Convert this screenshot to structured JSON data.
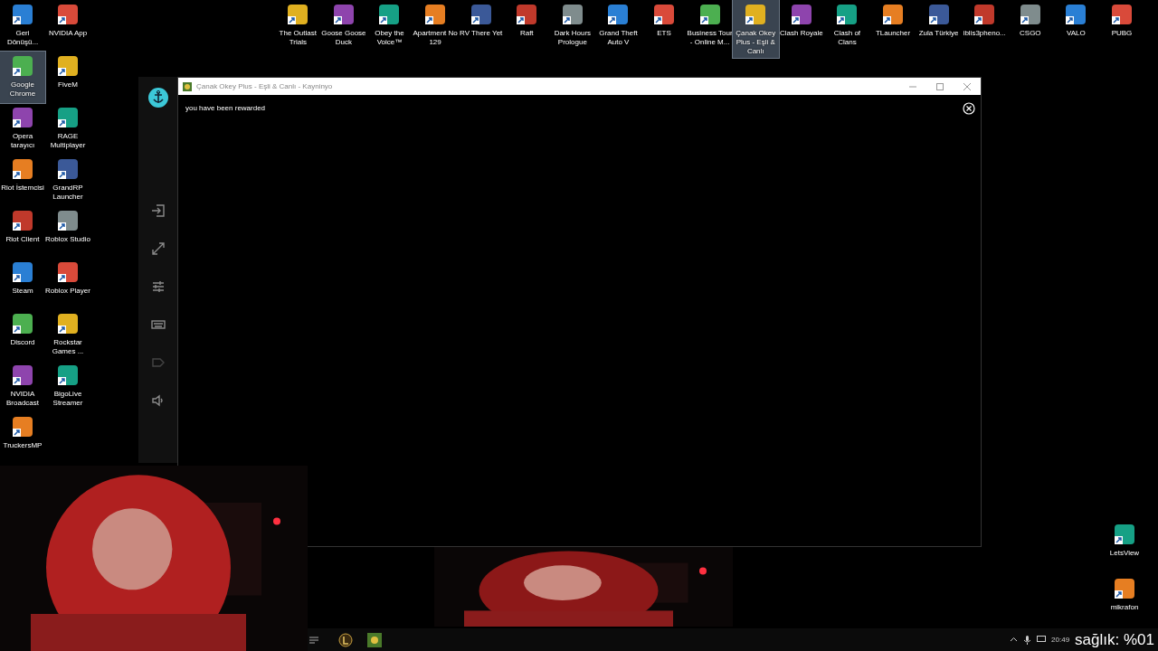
{
  "desktop_top_icons": [
    {
      "label": "The Outlast Trials",
      "selected": false
    },
    {
      "label": "Goose Goose Duck",
      "selected": false
    },
    {
      "label": "Obey the Voice™",
      "selected": false
    },
    {
      "label": "Apartment No 129",
      "selected": false
    },
    {
      "label": "RV There Yet",
      "selected": false
    },
    {
      "label": "Raft",
      "selected": false
    },
    {
      "label": "Dark Hours Prologue",
      "selected": false
    },
    {
      "label": "Grand Theft Auto V",
      "selected": false
    },
    {
      "label": "ETS",
      "selected": false
    },
    {
      "label": "Business Tour - Online M...",
      "selected": false
    },
    {
      "label": "Çanak Okey Plus - Eşli & Canlı",
      "selected": true
    },
    {
      "label": "Clash Royale",
      "selected": false
    },
    {
      "label": "Clash of Clans",
      "selected": false
    },
    {
      "label": "TLauncher",
      "selected": false
    },
    {
      "label": "Zula Türkiye",
      "selected": false
    },
    {
      "label": "iblis3pheno...",
      "selected": false
    },
    {
      "label": "CSGO",
      "selected": false
    },
    {
      "label": "VALO",
      "selected": false
    },
    {
      "label": "PUBG",
      "selected": false
    }
  ],
  "desktop_left_icons": [
    {
      "label": "Geri Dönüşü...",
      "selected": false
    },
    {
      "label": "NVIDIA App",
      "selected": false
    },
    {
      "label": "Google Chrome",
      "selected": true
    },
    {
      "label": "FiveM",
      "selected": false
    },
    {
      "label": "Opera tarayıcı",
      "selected": false
    },
    {
      "label": "RAGE Multiplayer",
      "selected": false
    },
    {
      "label": "Riot İstemcisi",
      "selected": false
    },
    {
      "label": "GrandRP Launcher",
      "selected": false
    },
    {
      "label": "Riot Client",
      "selected": false
    },
    {
      "label": "Roblox Studio",
      "selected": false
    },
    {
      "label": "Steam",
      "selected": false
    },
    {
      "label": "Roblox Player",
      "selected": false
    },
    {
      "label": "Discord",
      "selected": false
    },
    {
      "label": "Rockstar Games ...",
      "selected": false
    },
    {
      "label": "NVIDIA Broadcast",
      "selected": false
    },
    {
      "label": "BigoLive Streamer",
      "selected": false
    },
    {
      "label": "TruckersMP",
      "selected": false
    }
  ],
  "desktop_right_icons": [
    {
      "label": "LetsView",
      "selected": false
    },
    {
      "label": "mikrafon",
      "selected": false
    }
  ],
  "window": {
    "title": "Çanak Okey Plus - Eşli & Canlı - Kayninyo",
    "message": "you have been rewarded"
  },
  "taskbar": {
    "clock": "20:49"
  },
  "overlay": {
    "text": "sağlık: %01"
  }
}
